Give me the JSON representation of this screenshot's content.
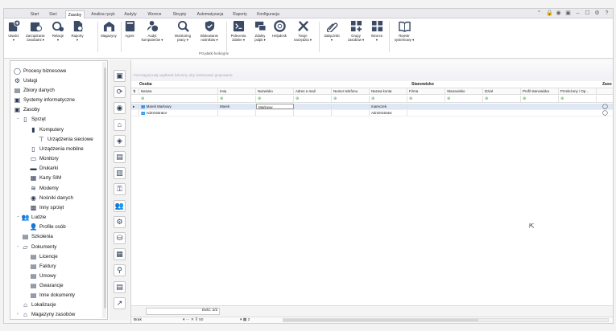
{
  "menu": {
    "tabs": [
      "Start",
      "Sieć",
      "Zasoby",
      "Analiza ryzyk",
      "Audyty",
      "Wzorce",
      "Skrypty",
      "Automatyzacja",
      "Raporty",
      "Konfiguracja"
    ],
    "active": "Zasoby"
  },
  "ribbon": {
    "buttons": [
      {
        "label": "Utwórz",
        "sub": "▾",
        "icon": "create-icon"
      },
      {
        "label": "Zarządzanie",
        "sub": "zasobami ▾",
        "icon": "manage-assets-icon"
      },
      {
        "label": "Relacje",
        "sub": "▾",
        "icon": "relations-icon"
      },
      {
        "label": "Raporty",
        "sub": "▾",
        "icon": "reports-icon"
      },
      {
        "label": "Magazyny",
        "sub": "",
        "icon": "warehouse-icon"
      },
      {
        "label": "Agent",
        "sub": "",
        "icon": "agent-icon"
      },
      {
        "label": "Audyt",
        "sub": "komputerów ▾",
        "icon": "audit-icon"
      },
      {
        "label": "Monitoring",
        "sub": "pracy ▾",
        "icon": "monitoring-icon"
      },
      {
        "label": "Blokowanie",
        "sub": "nośników ▾",
        "icon": "blocking-icon"
      },
      {
        "label": "Polecenia",
        "sub": "zdalne ▾",
        "icon": "remote-commands-icon"
      },
      {
        "label": "Zdalny",
        "sub": "pulpit ▾",
        "icon": "remote-desktop-icon"
      },
      {
        "label": "Helpdesk",
        "sub": "",
        "icon": "helpdesk-icon"
      },
      {
        "label": "Twoje",
        "sub": "narzędzia ▾",
        "icon": "tools-icon"
      },
      {
        "label": "Załączniki",
        "sub": "▾",
        "icon": "attachments-icon"
      },
      {
        "label": "Grupy",
        "sub": "zasobów ▾",
        "icon": "groups-icon"
      },
      {
        "label": "Wzorce",
        "sub": "▾",
        "icon": "templates-icon"
      },
      {
        "label": "Rejestr",
        "sub": "systemowy ▾",
        "icon": "registry-icon"
      }
    ],
    "group_label": "Przydatki funkcyjne"
  },
  "tree": [
    {
      "label": "Procesy biznesowe",
      "icon": "process-icon"
    },
    {
      "label": "Usługi",
      "icon": "services-icon"
    },
    {
      "label": "Zbiory danych",
      "icon": "datasets-icon"
    },
    {
      "label": "Systemy informatyczne",
      "icon": "systems-icon"
    },
    {
      "label": "Zasoby",
      "icon": "assets-icon"
    },
    {
      "label": "Sprzęt",
      "icon": "hardware-icon"
    },
    {
      "label": "Komputery",
      "icon": "computer-icon"
    },
    {
      "label": "Urządzenia sieciowe",
      "icon": "network-device-icon"
    },
    {
      "label": "Urządzenia mobilne",
      "icon": "mobile-device-icon"
    },
    {
      "label": "Monitory",
      "icon": "monitor-icon"
    },
    {
      "label": "Drukarki",
      "icon": "printer-icon"
    },
    {
      "label": "Karty SIM",
      "icon": "sim-card-icon"
    },
    {
      "label": "Modemy",
      "icon": "modem-icon"
    },
    {
      "label": "Nośniki danych",
      "icon": "storage-media-icon"
    },
    {
      "label": "Inny sprzęt",
      "icon": "other-hardware-icon"
    },
    {
      "label": "Ludzie",
      "icon": "people-icon"
    },
    {
      "label": "Profile osób",
      "icon": "person-profile-icon"
    },
    {
      "label": "Szkolenia",
      "icon": "training-icon"
    },
    {
      "label": "Dokumenty",
      "icon": "documents-icon"
    },
    {
      "label": "Licencje",
      "icon": "license-icon"
    },
    {
      "label": "Faktury",
      "icon": "invoice-icon"
    },
    {
      "label": "Umowy",
      "icon": "contract-icon"
    },
    {
      "label": "Gwarancje",
      "icon": "warranty-icon"
    },
    {
      "label": "Inne dokumenty",
      "icon": "other-docs-icon"
    },
    {
      "label": "Lokalizacje",
      "icon": "locations-icon"
    },
    {
      "label": "Magazyny zasobów",
      "icon": "asset-warehouse-icon"
    }
  ],
  "grid": {
    "group_hint": "Przeciągnij tutaj nagłówek kolumny, aby zastosować grupowanie",
    "groups": [
      "Osoba",
      "Stanowisko",
      "Zaso"
    ],
    "columns": [
      "Nazwa",
      "Imię",
      "Nazwisko",
      "Adres e-mail",
      "Numer telefonu",
      "Nazwa konta",
      "Firma",
      "Stanowisko",
      "Dział",
      "Profil stanowiska",
      "Przełożony / Op..."
    ],
    "rows": [
      {
        "name": "Marek Markowy",
        "first": "Marek",
        "last": "Markowy",
        "account": "mareczek"
      },
      {
        "name": "Administrator",
        "first": "",
        "last": "",
        "account": "Administrator"
      }
    ],
    "count": "Ilość: 2/2",
    "status_left": "Brak",
    "page_size": "50",
    "page_num": "2"
  }
}
